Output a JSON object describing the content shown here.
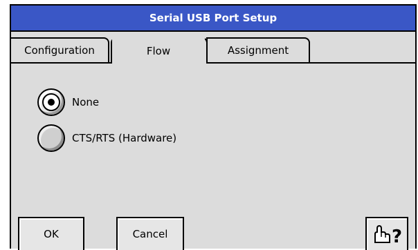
{
  "window": {
    "title": "Serial USB Port Setup"
  },
  "tabs": [
    {
      "label": "Configuration",
      "active": false
    },
    {
      "label": "Flow",
      "active": true
    },
    {
      "label": "Assignment",
      "active": false
    }
  ],
  "flow_options": [
    {
      "label": "None",
      "selected": true
    },
    {
      "label": "CTS/RTS (Hardware)",
      "selected": false
    }
  ],
  "buttons": {
    "ok_label": "OK",
    "cancel_label": "Cancel",
    "help_icon": "pointing-hand-question-icon"
  },
  "colors": {
    "title_bar": "#3a57c6",
    "dialog_background": "#dcdcdc"
  }
}
